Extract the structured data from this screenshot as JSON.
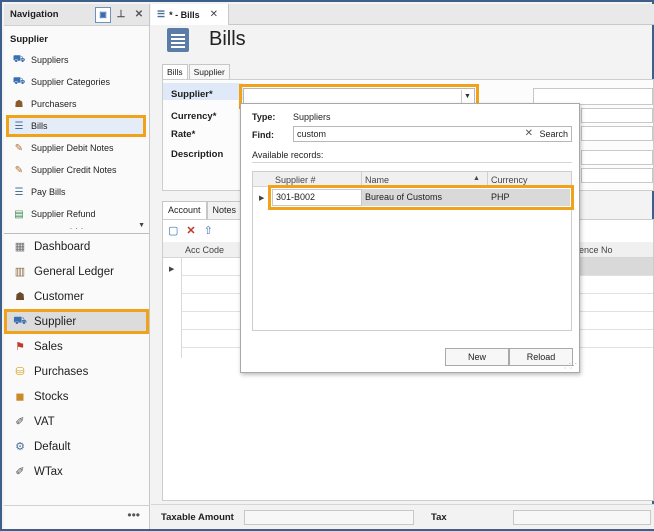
{
  "navigation": {
    "title": "Navigation",
    "group": "Supplier",
    "sub_items": [
      {
        "label": "Suppliers",
        "icon": "suppliers-icon"
      },
      {
        "label": "Supplier Categories",
        "icon": "categories-icon"
      },
      {
        "label": "Purchasers",
        "icon": "person-icon"
      },
      {
        "label": "Bills",
        "icon": "bills-icon"
      },
      {
        "label": "Supplier Debit Notes",
        "icon": "note-icon"
      },
      {
        "label": "Supplier Credit Notes",
        "icon": "note-icon"
      },
      {
        "label": "Pay Bills",
        "icon": "pay-icon"
      },
      {
        "label": "Supplier Refund",
        "icon": "refund-icon"
      }
    ],
    "main_items": [
      {
        "label": "Dashboard"
      },
      {
        "label": "General Ledger"
      },
      {
        "label": "Customer"
      },
      {
        "label": "Supplier"
      },
      {
        "label": "Sales"
      },
      {
        "label": "Purchases"
      },
      {
        "label": "Stocks"
      },
      {
        "label": "VAT"
      },
      {
        "label": "Default"
      },
      {
        "label": "WTax"
      }
    ],
    "more": "•••"
  },
  "doc_tab": {
    "label": "* - Bills",
    "close": "✕"
  },
  "page_title": "Bills",
  "form": {
    "tabs": [
      "Bills",
      "Supplier"
    ],
    "labels": {
      "supplier": "Supplier*",
      "currency": "Currency*",
      "rate": "Rate*",
      "description": "Description"
    }
  },
  "account": {
    "tabs": [
      "Account",
      "Notes"
    ],
    "col_acc_code": "Acc Code",
    "col_reference": "erence No"
  },
  "bottom": {
    "taxable_amount": "Taxable Amount",
    "tax": "Tax"
  },
  "popup": {
    "type_label": "Type:",
    "type_value": "Suppliers",
    "find_label": "Find:",
    "find_value": "custom",
    "search_label": "Search",
    "available_label": "Available records:",
    "columns": [
      "Supplier #",
      "Name",
      "Currency"
    ],
    "rows": [
      {
        "supplier_no": "301-B002",
        "name": "Bureau of Customs",
        "currency": "PHP"
      }
    ],
    "new_button": "New",
    "reload_button": "Reload"
  },
  "colors": {
    "highlight": "#f0a21a",
    "selected_bg": "#e3ecf7",
    "frame_border": "#3c5f8c"
  }
}
